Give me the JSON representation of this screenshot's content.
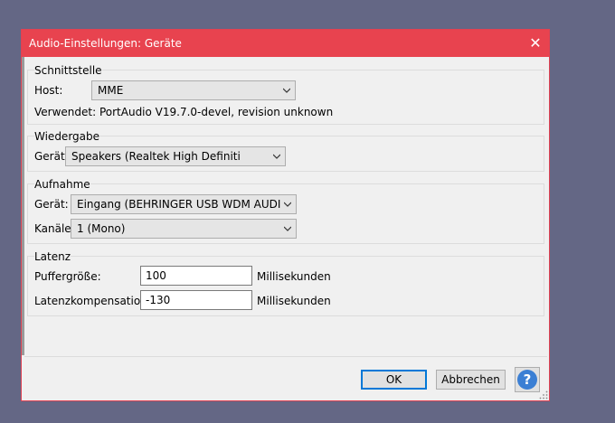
{
  "window": {
    "title": "Audio-Einstellungen: Geräte",
    "close_symbol": "✕"
  },
  "schnittstelle": {
    "label": "Schnittstelle",
    "host_label": "Host:",
    "host_value": "MME",
    "verwendet_text": "Verwendet: PortAudio V19.7.0-devel, revision unknown"
  },
  "wiedergabe": {
    "label": "Wiedergabe",
    "geraet_label": "Gerät:",
    "geraet_value": "Speakers (Realtek High Definiti"
  },
  "aufnahme": {
    "label": "Aufnahme",
    "geraet_label": "Gerät:",
    "geraet_value": "Eingang (BEHRINGER USB WDM AUDI",
    "kanaele_label": "Kanäle:",
    "kanaele_value": "1 (Mono)"
  },
  "latenz": {
    "label": "Latenz",
    "puffer_label": "Puffergröße:",
    "puffer_value": "100",
    "puffer_unit": "Millisekunden",
    "komp_label": "Latenzkompensation:",
    "komp_value": "-130",
    "komp_unit": "Millisekunden"
  },
  "buttons": {
    "ok": "OK",
    "cancel": "Abbrechen",
    "help": "?"
  },
  "icons": {
    "close": "close-icon",
    "dropdown": "chevron-down-icon",
    "help": "help-icon",
    "grip": "resize-grip-icon"
  },
  "colors": {
    "titlebar": "#e8434f",
    "desktop": "#646785",
    "dialog_bg": "#f0f0f0",
    "accent": "#0078d7"
  }
}
